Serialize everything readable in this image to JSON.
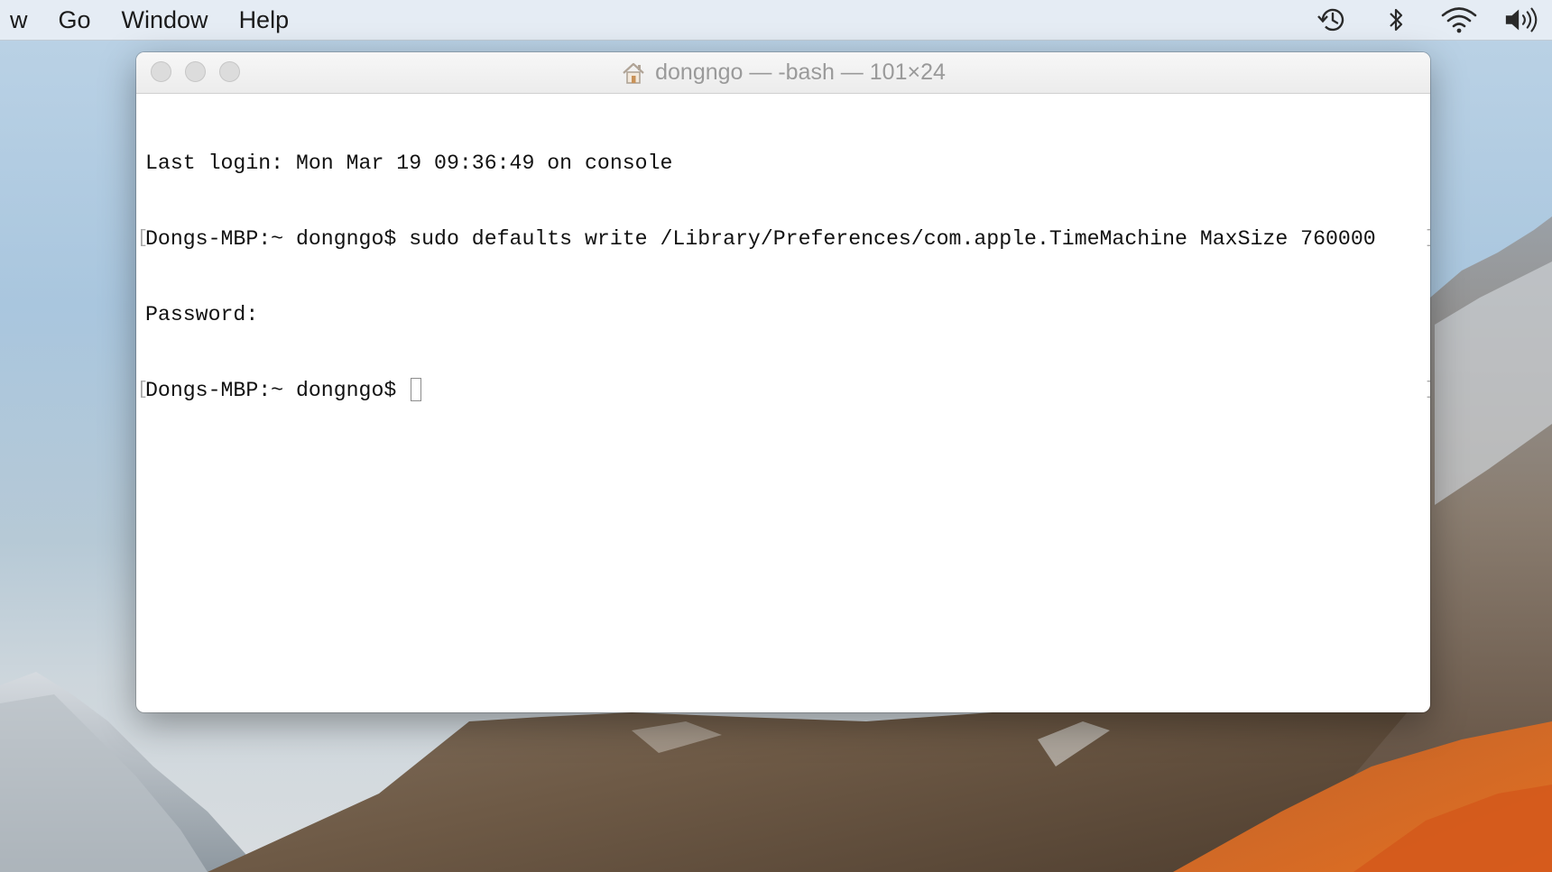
{
  "menubar": {
    "items": [
      {
        "label": "w"
      },
      {
        "label": "Go"
      },
      {
        "label": "Window"
      },
      {
        "label": "Help"
      }
    ],
    "status_icons": [
      "time-machine-icon",
      "bluetooth-icon",
      "wifi-icon",
      "volume-icon"
    ]
  },
  "window": {
    "title": "dongngo — -bash — 101×24",
    "title_icon": "home-icon",
    "lines": [
      {
        "text": "Last login: Mon Mar 19 09:36:49 on console"
      },
      {
        "text": "Dongs-MBP:~ dongngo$ sudo defaults write /Library/Preferences/com.apple.TimeMachine MaxSize 760000"
      },
      {
        "text": "Password:"
      },
      {
        "text": "Dongs-MBP:~ dongngo$ "
      }
    ]
  }
}
